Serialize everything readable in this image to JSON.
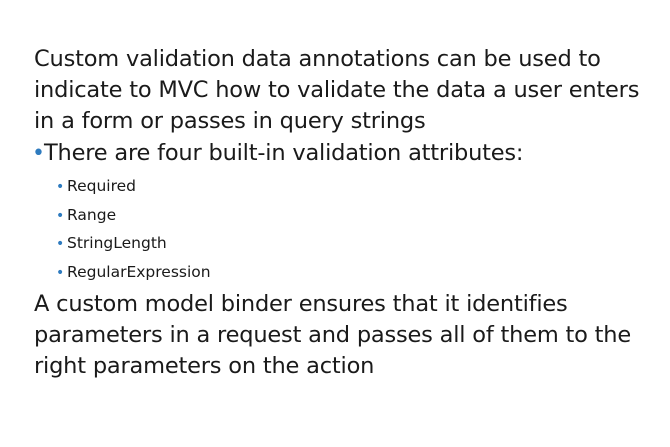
{
  "intro": "Custom validation data annotations can be used to indicate to MVC how to validate the data a user enters in a form or passes in query strings",
  "bullet": "There are four built-in validation attributes:",
  "attributes": [
    "Required",
    "Range",
    "StringLength",
    "RegularExpression"
  ],
  "closing": "A custom model binder ensures that it identifies parameters in a request and passes all of them to the right parameters on the action",
  "colors": {
    "text": "#1a1a1a",
    "bullet": "#2e7bbf",
    "background": "#ffffff"
  }
}
